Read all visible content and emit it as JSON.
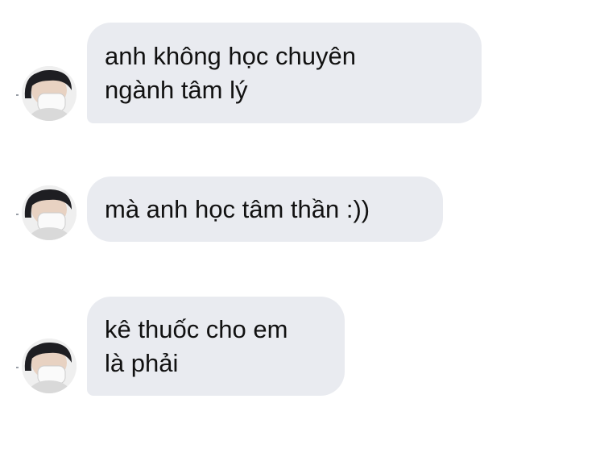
{
  "messages": [
    {
      "sender": "avatar",
      "lines": [
        "anh không học chuyên",
        "ngành tâm lý"
      ]
    },
    {
      "sender": "avatar",
      "lines": [
        "mà anh học tâm thần :))"
      ]
    },
    {
      "sender": "avatar",
      "lines": [
        "kê thuốc cho em",
        "là phải"
      ]
    }
  ],
  "colors": {
    "bubble_bg": "#e9ebf0",
    "text": "#111111",
    "background": "#ffffff"
  }
}
